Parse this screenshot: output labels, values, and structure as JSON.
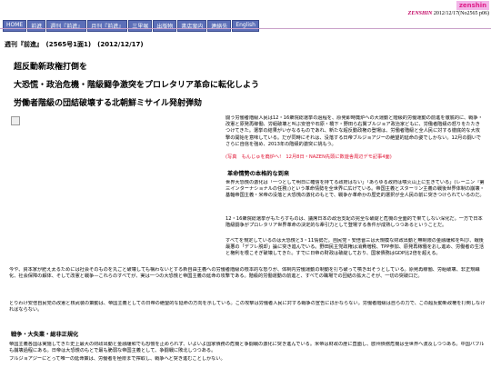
{
  "header": {
    "logo_text": "zenshin",
    "issue_line_brand": "ZENSHIN",
    "issue_line_rest": "2012/12/17(No2565 p06)",
    "nav": [
      "HOME",
      "前進",
      "週刊『前進』",
      "月刊『前進』",
      "三里塚",
      "出版物",
      "書店案内",
      "連絡先",
      "English"
    ]
  },
  "article": {
    "meta": "週刊『前進』　(2565号1面1)　(2012/12/17)",
    "headline1": "超反動新政権打倒を",
    "headline2": "大恐慌・政治危機・階級闘争激突をプロレタリア革命に転化しよう",
    "headline3": "労働者階級の団結破壊する北朝鮮ミサイル発射弾劾",
    "lead": "闘う労働者階級人民は12・16衆院総選挙の過程を、原発即時廃炉への大運動と階級的労働運動の前進を徹底的に、戦争・改憲と原発再稼働、労組破壊と叫ぶ安倍や石原・橋下・野田ら右翼ブルジョア政治家どもに、労働者階級の怒りをたたきつけてきた。選挙の結果がいかなるものであれ、新たな超反動政権の登場は、労働者階級と全人民に対する徹底的な大攻撃の開始を意味している。だが同時にそれは、没落する日帝ブルジョアジーの絶望的延命の姿でしかない。12月の闘いでさらに自信を強め、2013年の階級的激突に挑もう。",
    "lead_red": "(写真　もんじゅを廃炉へ!　12月8日・NAZEN先頭に数遊舎周辺デモ記事4面)",
    "section1_title": "革命情勢の本格的な到来",
    "section1_p1": "世界大恐慌の激化は「一つとして明日に確信を持てる政府はない」「あらゆる政府は噴火山上に生きている」(レーニン『第三インターナショナルの任務』)という革命情勢を全世界に広げている。帝国主義とスターリン主義の戦後世界体制の崩壊・基軸帝国主義・米帝の没落と大恐慌の激化のもとで、戦争か革命かの歴史的選択が全人民の前に突きつけられているのだ。",
    "section1_p2": "12・16衆院総選挙がもたらすものは、議席日本の政治支配の完全な破綻と危機の全面的で果てしない深化だ。一方で日本階級闘争がプロレタリア世界革命の決定的な牽引力として登場する条件が成熟しつつあるということだ。",
    "section1_p3": "すべてを規定しているのは大恐慌と3・11情勢だ。自民党・安倍晋三は大規模な財政出動と無制限の金融緩和を叫び、戦後最悪の「デフレ脱却」論に突き進んでいる。野田民主党政権は消費増税、TPP参加、原発再稼働をおし進め、労働者の生活と権利を根こそぎ破壊してきた。すでに日帝の財政は破綻しており、国家債務はGDP比2倍を超える。",
    "wide_p1": "今や、資本家が肥え太るためには社会そのものを丸ごと破壊しても構わないとする新自由主義への労働者階級の根本的な怒りが、体制内労働運動の制動を打ち破って噴き出そうとしている。原発再稼働、労組破壊、非正規職化、社会保障の解体、そして改憲と戦争—これらのすべてが、実は一つの大恐慌と帝国主義の延命の攻撃である。階級的労働運動の前進と、すべての職場での団結の拡大こそが、一切の突破口だ。",
    "wide_p2": "とりわけ安倍自民党の改憲と核武装の策動は、帝国主義としての日帝の絶望的な延命の方向を示している。この攻撃は労働者人民に対する戦争の宣告にほかならない。労働者階級は自らの力で、この超反動新政権を打倒しなければならない。",
    "section2_title": "戦争・大失業・総非正規化",
    "bottom_p1": "帝国主義各国は実施してきた史上最大の財政出動と金融緩和でも恐慌を止められず、いよいよ国家債務の危機と争闘戦の激化に突き進んでいる。米帝は財政の崖に直面し、欧州債務危機は全世界へ波及しつつある。中国バブルも崩壊過程にある。日帝は大恐慌のもとで最も脆弱な帝国主義として、争闘戦に敗北しつつある。",
    "bottom_p2": "ブルジョアジーにとって唯一の延命策は、労働者を極限まで搾取し、戦争へと突き進むことしかない。"
  }
}
